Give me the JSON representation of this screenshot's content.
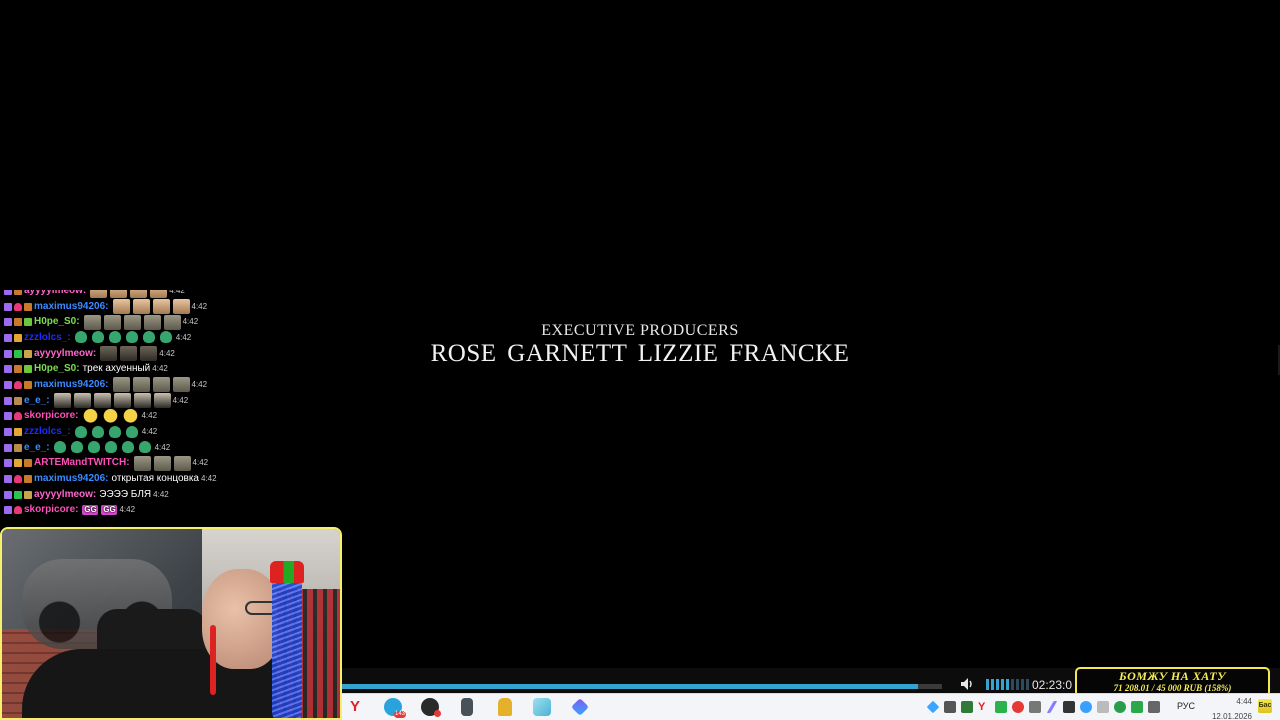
{
  "video": {
    "credit_role": "EXECUTIVE PRODUCERS",
    "credit_names": "ROSE GARNETT  LIZZIE FRANCKE"
  },
  "chat": {
    "messages": [
      {
        "user": "ayyyylmeow",
        "color": "#ff66cc",
        "badges": [
          "sub",
          "bit"
        ],
        "text": "",
        "emotes": [
          "face",
          "face",
          "face",
          "face"
        ],
        "time": "4:42",
        "partial": true
      },
      {
        "user": "maximus94206",
        "color": "#3b8bff",
        "badges": [
          "sub",
          "heart",
          "bit"
        ],
        "text": "",
        "emotes": [
          "face",
          "face",
          "face",
          "face"
        ],
        "time": "4:42"
      },
      {
        "user": "H0pe_S0",
        "color": "#7ddc4f",
        "badges": [
          "sub",
          "bit",
          "lime"
        ],
        "text": "",
        "emotes": [
          "stone",
          "stone",
          "stone",
          "stone",
          "stone"
        ],
        "time": "4:42"
      },
      {
        "user": "zzzlolcs_",
        "color": "#1e2bff",
        "badges": [
          "sub",
          "gold"
        ],
        "text": "",
        "emotes": [
          "pepe",
          "pepe",
          "pepe",
          "pepe",
          "pepe",
          "pepe"
        ],
        "time": "4:42"
      },
      {
        "user": "ayyyylmeow",
        "color": "#ff66cc",
        "badges": [
          "sub",
          "green",
          "prime"
        ],
        "text": "",
        "emotes": [
          "cat",
          "cat",
          "cat"
        ],
        "time": "4:42"
      },
      {
        "user": "H0pe_S0",
        "color": "#7ddc4f",
        "badges": [
          "sub",
          "bit",
          "lime"
        ],
        "text": "трек ахуенный",
        "emotes": [],
        "time": "4:42"
      },
      {
        "user": "maximus94206",
        "color": "#3b8bff",
        "badges": [
          "sub",
          "heart",
          "bit"
        ],
        "text": "",
        "emotes": [
          "stone",
          "stone",
          "stone",
          "stone"
        ],
        "time": "4:42"
      },
      {
        "user": "e_e_",
        "color": "#3b8bff",
        "badges": [
          "sub",
          "bag"
        ],
        "text": "",
        "emotes": [
          "dark",
          "dark",
          "dark",
          "dark",
          "dark",
          "dark"
        ],
        "time": "4:42"
      },
      {
        "user": "skorpicore",
        "color": "#ff4fb8",
        "badges": [
          "sub",
          "heart"
        ],
        "text": "",
        "emotes": [
          "yellow",
          "yellow",
          "yellow"
        ],
        "time": "4:42"
      },
      {
        "user": "zzzlolcs_",
        "color": "#1e2bff",
        "badges": [
          "sub",
          "gold"
        ],
        "text": "",
        "emotes": [
          "pepe",
          "pepe",
          "pepe",
          "pepe"
        ],
        "time": "4:42"
      },
      {
        "user": "e_e_",
        "color": "#3b8bff",
        "badges": [
          "sub",
          "bag"
        ],
        "text": "",
        "emotes": [
          "pepe",
          "pepe",
          "pepe",
          "pepe",
          "pepe",
          "pepe"
        ],
        "time": "4:42"
      },
      {
        "user": "ARTEMandTWITCH",
        "color": "#ff4fb8",
        "badges": [
          "sub",
          "gold",
          "bit"
        ],
        "text": "",
        "emotes": [
          "stone",
          "stone",
          "stone"
        ],
        "time": "4:42"
      },
      {
        "user": "maximus94206",
        "color": "#3b8bff",
        "badges": [
          "sub",
          "heart",
          "bit"
        ],
        "text": "открытая концовка",
        "emotes": [],
        "time": "4:42"
      },
      {
        "user": "ayyyylmeow",
        "color": "#ff66cc",
        "badges": [
          "sub",
          "green",
          "prime"
        ],
        "text": "ЭЭЭЭ БЛЯ",
        "emotes": [],
        "time": "4:42"
      },
      {
        "user": "skorpicore",
        "color": "#ff4fb8",
        "badges": [
          "sub",
          "heart"
        ],
        "text": "",
        "emotes": [
          "gg",
          "gg"
        ],
        "time": "4:42"
      }
    ],
    "gg_label": "GG"
  },
  "player": {
    "progress_fraction": 0.96,
    "volume_bars_on": 5,
    "volume_bars_total": 9,
    "time": "02:23:0",
    "accent": "#35a3cf"
  },
  "goal": {
    "title": "БОМЖУ НА ХАТУ",
    "amount": "71 208.01 / 45 000 RUB (158%)",
    "accent": "#f4e84c"
  },
  "taskbar": {
    "apps": [
      "yandex-browser-icon",
      "telegram-icon",
      "obs-icon",
      "file-icon",
      "lock-icon",
      "glass-icon",
      "diamond-icon"
    ],
    "yandex_glyph": "Y",
    "tray_yandex_glyph": "Y",
    "language": "РУС",
    "time": "4:44",
    "date": "12.01.2026",
    "notif_label": "Бас"
  }
}
